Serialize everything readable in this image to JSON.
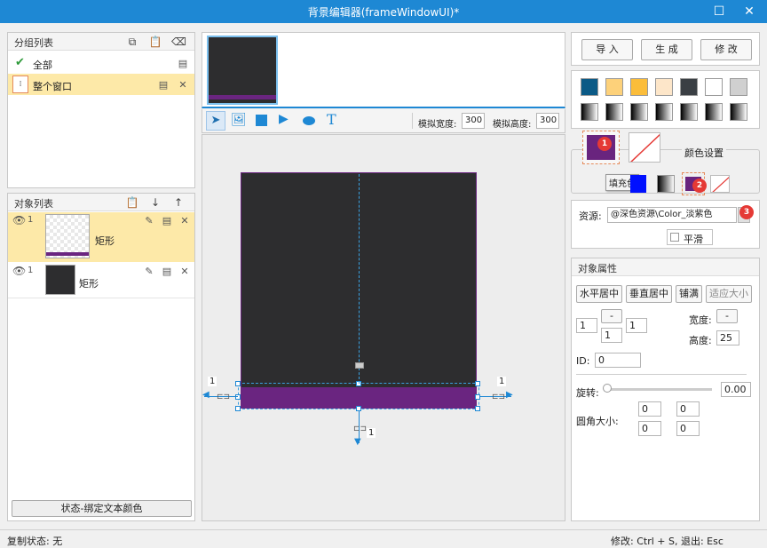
{
  "window": {
    "title": "背景编辑器(frameWindowUI)*",
    "maximize_glyph": "☐",
    "close_glyph": "✕"
  },
  "group_list": {
    "title": "分组列表",
    "items": [
      {
        "label": "全部",
        "check": "✔"
      },
      {
        "label": "整个窗口",
        "delete": "✕"
      }
    ]
  },
  "object_list": {
    "title": "对象列表",
    "items": [
      {
        "index": "1",
        "label": "矩形",
        "delete": "✕"
      },
      {
        "index": "1",
        "label": "矩形",
        "delete": "✕"
      }
    ],
    "down_arrow": "↓",
    "up_arrow": "↑"
  },
  "left_footer": {
    "label": "状态-绑定文本颜色"
  },
  "toolbar": {
    "sim_width_label": "模拟宽度:",
    "sim_width_value": "300",
    "sim_height_label": "模拟高度:",
    "sim_height_value": "300",
    "text_tool": "T"
  },
  "canvas": {
    "left_value": "1",
    "right_value": "1",
    "bottom_value": "1"
  },
  "actions": {
    "import": "导 入",
    "generate": "生 成",
    "modify": "修 改"
  },
  "colors": {
    "palette": [
      "#0b5a86",
      "#fdd17a",
      "#fbbd3a",
      "#fde6c9",
      "#3a3f44",
      "#ffffff",
      "#d0d0d0"
    ],
    "fill_color": "#69247e",
    "bottom_bar": "#6a2580",
    "canvas_bg": "#2d2d2f"
  },
  "color_settings": {
    "title": "颜色设置",
    "badge1": "1",
    "badge2": "2",
    "badge3": "3",
    "tooltip": "填充色"
  },
  "resource": {
    "label": "资源:",
    "value": "@深色资源\\Color_淡紫色",
    "smooth_label": "平滑"
  },
  "props": {
    "title": "对象属性",
    "h_center": "水平居中",
    "v_center": "垂直居中",
    "fill": "铺满",
    "fit": "适应大小",
    "left_val": "1",
    "top_val": "1",
    "right_val": "1",
    "dash": "-",
    "width_label": "宽度:",
    "width_val": "-",
    "height_label": "高度:",
    "height_val": "25",
    "id_label": "ID:",
    "id_val": "0",
    "rotate_label": "旋转:",
    "rotate_val": "0.00",
    "corner_label": "圆角大小:",
    "corner_vals": [
      "0",
      "0",
      "0",
      "0"
    ]
  },
  "status": {
    "copy_state": "复制状态: 无",
    "shortcuts": "修改: Ctrl + S, 退出: Esc"
  }
}
